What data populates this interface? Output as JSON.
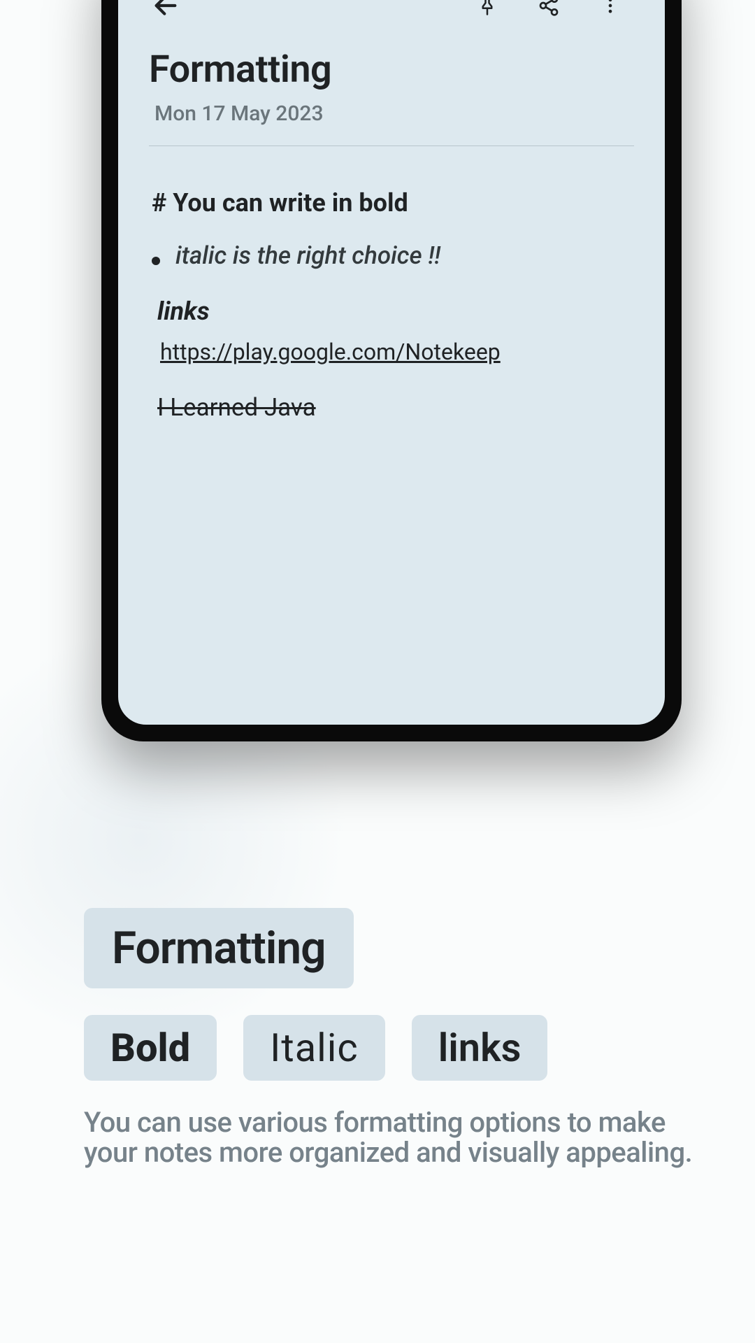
{
  "note": {
    "title": "Formatting",
    "date": "Mon  17 May 2023",
    "body": {
      "bold_line": "# You can write in bold",
      "italic_line": "italic is the right choice !!",
      "links_label": "links",
      "link_url": "https://play.google.com/Notekeep",
      "strike_line": " I Learned Java "
    }
  },
  "promo": {
    "chip_main": "Formatting",
    "chip_bold": "Bold",
    "chip_italic": "Italic",
    "chip_links": "links",
    "description": "You can use various formatting options to make your notes more organized and visually appealing."
  }
}
